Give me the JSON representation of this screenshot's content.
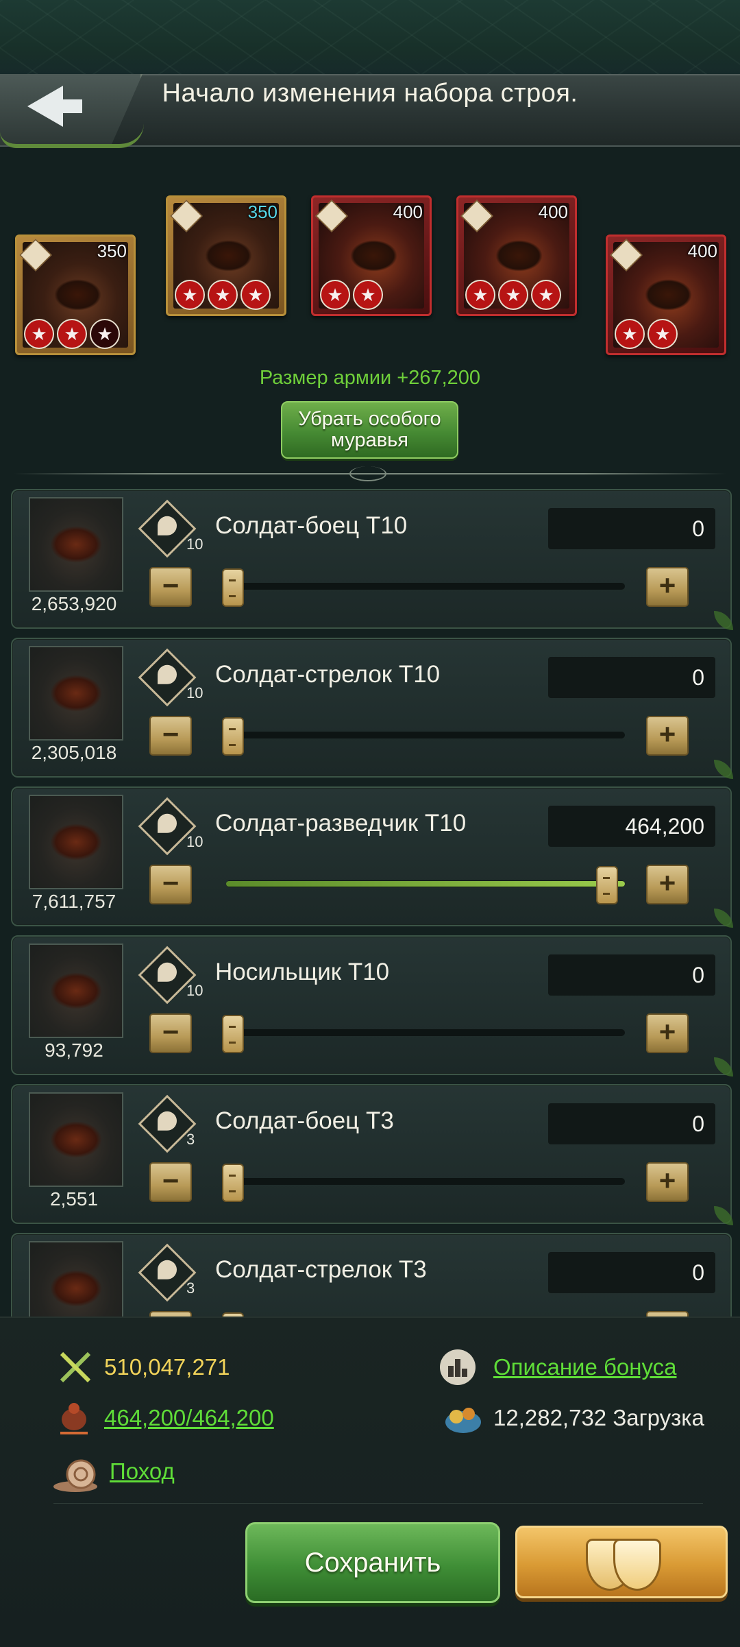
{
  "header": {
    "title": "Начало изменения набора строя."
  },
  "heroes": [
    {
      "level": "350",
      "stars_filled": 2,
      "stars_total": 3,
      "frame": "gold"
    },
    {
      "level": "350",
      "stars_filled": 3,
      "stars_total": 3,
      "frame": "gold",
      "level_color": "cyan"
    },
    {
      "level": "400",
      "stars_filled": 2,
      "stars_total": 2,
      "frame": "red"
    },
    {
      "level": "400",
      "stars_filled": 3,
      "stars_total": 3,
      "frame": "red"
    },
    {
      "level": "400",
      "stars_filled": 2,
      "stars_total": 2,
      "frame": "red"
    }
  ],
  "army_size": "Размер армии +267,200",
  "remove_special_button": "Убрать особого муравья",
  "troops": [
    {
      "name": "Солдат-боец T10",
      "tier": "10",
      "available": "2,653,920",
      "value": "0",
      "fill": 0.0,
      "icon": "shield-icon"
    },
    {
      "name": "Солдат-стрелок T10",
      "tier": "10",
      "available": "2,305,018",
      "value": "0",
      "fill": 0.0,
      "icon": "archer-icon"
    },
    {
      "name": "Солдат-разведчик T10",
      "tier": "10",
      "available": "7,611,757",
      "value": "464,200",
      "fill": 1.0,
      "icon": "scout-icon"
    },
    {
      "name": "Носильщик T10",
      "tier": "10",
      "available": "93,792",
      "value": "0",
      "fill": 0.0,
      "icon": "carrier-icon"
    },
    {
      "name": "Солдат-боец T3",
      "tier": "3",
      "available": "2,551",
      "value": "0",
      "fill": 0.0,
      "icon": "shield-icon"
    },
    {
      "name": "Солдат-стрелок T3",
      "tier": "3",
      "available": "",
      "value": "0",
      "fill": 0.0,
      "icon": "archer-icon"
    }
  ],
  "stats": {
    "power": "510,047,271",
    "bonus_link": "Описание бонуса",
    "troops_ratio": "464,200/464,200",
    "load_value": "12,282,732",
    "load_label": "Загрузка",
    "march_link": "Поход"
  },
  "buttons": {
    "save": "Сохранить"
  },
  "colors": {
    "accent_green": "#6fcf3a",
    "gold": "#f1d35a",
    "link_green": "#5fdd38"
  }
}
